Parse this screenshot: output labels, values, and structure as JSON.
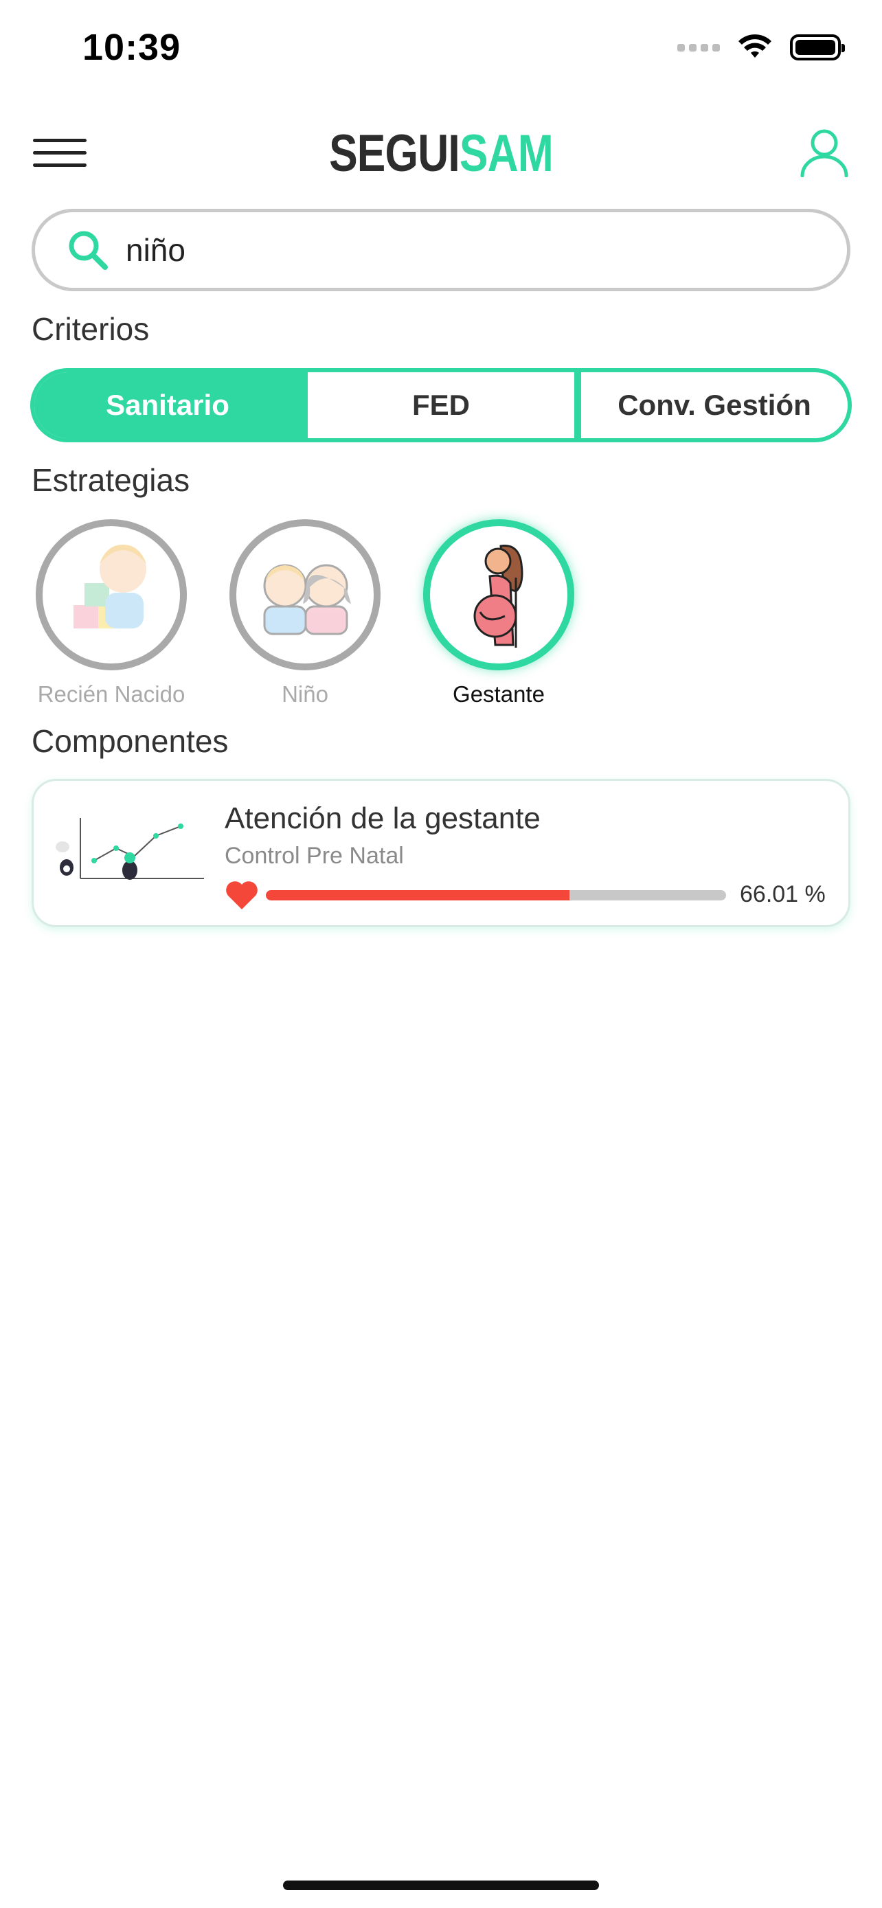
{
  "status_bar": {
    "time": "10:39"
  },
  "header": {
    "logo_part1": "SEGUI",
    "logo_part2": "SAM"
  },
  "search": {
    "value": "niño"
  },
  "criterios": {
    "title": "Criterios",
    "options": [
      {
        "label": "Sanitario",
        "active": true
      },
      {
        "label": "FED",
        "active": false
      },
      {
        "label": "Conv. Gestión",
        "active": false
      }
    ]
  },
  "estrategias": {
    "title": "Estrategias",
    "items": [
      {
        "label": "Recién Nacido",
        "icon": "newborn-icon",
        "active": false
      },
      {
        "label": "Niño",
        "icon": "children-icon",
        "active": false
      },
      {
        "label": "Gestante",
        "icon": "pregnant-woman-icon",
        "active": true
      }
    ]
  },
  "componentes": {
    "title": "Componentes",
    "items": [
      {
        "title": "Atención de la gestante",
        "subtitle": "Control Pre Natal",
        "progress_percent": 66.01,
        "progress_text": "66.01 %"
      }
    ]
  },
  "colors": {
    "accent": "#2ED8A0",
    "progress_fill": "#F4473A",
    "progress_track": "#C8C8C8",
    "inactive_ring": "#A9A9A9"
  }
}
